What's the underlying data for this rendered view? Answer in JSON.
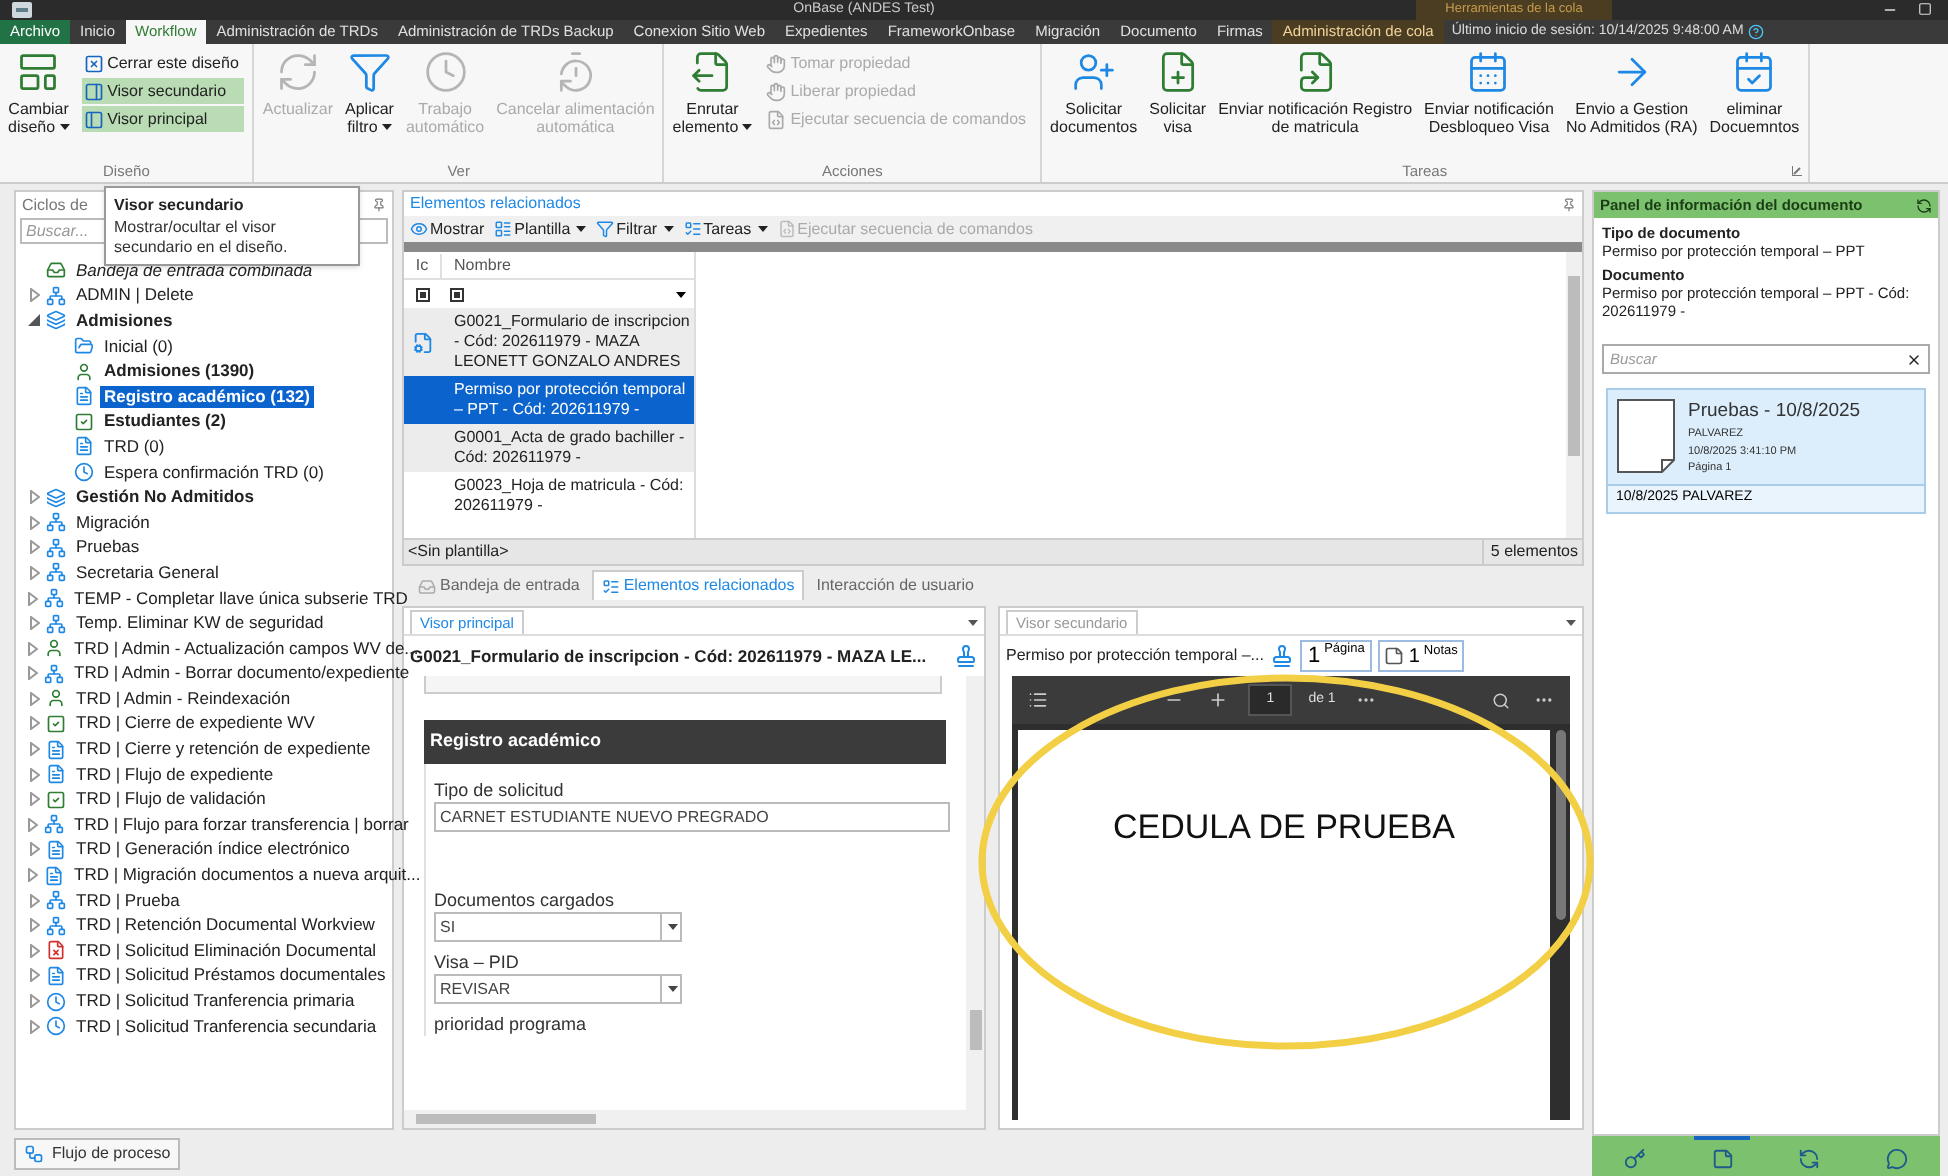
{
  "window": {
    "title": "OnBase (ANDES Test)",
    "context_label": "Herramientas de la cola"
  },
  "tabs": [
    {
      "label": "Archivo",
      "kind": "file",
      "selected": false
    },
    {
      "label": "Inicio",
      "kind": "normal",
      "selected": false
    },
    {
      "label": "Workflow",
      "kind": "normal",
      "selected": true
    },
    {
      "label": "Administración de TRDs",
      "kind": "normal",
      "selected": false
    },
    {
      "label": "Administración de TRDs Backup",
      "kind": "normal",
      "selected": false
    },
    {
      "label": "Conexion Sitio Web",
      "kind": "normal",
      "selected": false
    },
    {
      "label": "Expedientes",
      "kind": "normal",
      "selected": false
    },
    {
      "label": "FrameworkOnbase",
      "kind": "normal",
      "selected": false
    },
    {
      "label": "Migración",
      "kind": "normal",
      "selected": false
    },
    {
      "label": "Documento",
      "kind": "normal",
      "selected": false
    },
    {
      "label": "Firmas",
      "kind": "normal",
      "selected": false
    },
    {
      "label": "Administración de cola",
      "kind": "contextual",
      "selected": false
    }
  ],
  "last_login": "Último inicio de sesión: 10/14/2025 9:48:00 AM",
  "ribbon": [
    {
      "label": "Diseño",
      "items": [
        {
          "kind": "large",
          "label": "Cambiar\ndiseño",
          "dropdown": true,
          "disabled": false
        },
        {
          "kind": "small",
          "label": "Cerrar este diseño",
          "disabled": false,
          "selected": false
        },
        {
          "kind": "small",
          "label": "Visor secundario",
          "disabled": false,
          "selected": true
        },
        {
          "kind": "small",
          "label": "Visor principal",
          "disabled": false,
          "selected": true
        }
      ]
    },
    {
      "label": "Ver",
      "items": [
        {
          "kind": "large",
          "label": "Actualizar",
          "dropdown": false,
          "disabled": true
        },
        {
          "kind": "large",
          "label": "Aplicar\nfiltro",
          "dropdown": true,
          "disabled": false
        },
        {
          "kind": "large",
          "label": "Trabajo\nautomático",
          "dropdown": false,
          "disabled": true
        },
        {
          "kind": "large",
          "label": "Cancelar alimentación\nautomática",
          "dropdown": false,
          "disabled": true
        }
      ]
    },
    {
      "label": "Acciones",
      "items": [
        {
          "kind": "large",
          "label": "Enrutar\nelemento",
          "dropdown": true,
          "disabled": false
        },
        {
          "kind": "small",
          "label": "Tomar propiedad",
          "disabled": true,
          "selected": false
        },
        {
          "kind": "small",
          "label": "Liberar propiedad",
          "disabled": true,
          "selected": false
        },
        {
          "kind": "small",
          "label": "Ejecutar secuencia de comandos",
          "disabled": true,
          "selected": false
        }
      ]
    },
    {
      "label": "Tareas",
      "items": [
        {
          "kind": "large",
          "label": "Solicitar\ndocumentos",
          "dropdown": false,
          "disabled": false
        },
        {
          "kind": "large",
          "label": "Solicitar\nvisa",
          "dropdown": false,
          "disabled": false
        },
        {
          "kind": "large",
          "label": "Enviar notificación Registro\nde matricula",
          "dropdown": false,
          "disabled": false
        },
        {
          "kind": "large",
          "label": "Enviar notificación\nDesbloqueo Visa",
          "dropdown": false,
          "disabled": false
        },
        {
          "kind": "large",
          "label": "Envio a Gestion\nNo Admitidos (RA)",
          "dropdown": false,
          "disabled": false
        },
        {
          "kind": "large",
          "label": "eliminar\nDocuemntos",
          "dropdown": false,
          "disabled": false
        }
      ]
    }
  ],
  "tooltip": {
    "title": "Visor secundario",
    "text": "Mostrar/ocultar el visor secundario en el diseño."
  },
  "sidebar": {
    "title": "Ciclos de",
    "search_placeholder": "Buscar...",
    "items": [
      {
        "label": "Bandeja de entrada combinada",
        "kind": "inbox",
        "bold": false,
        "selected": false
      },
      {
        "label": "ADMIN | Delete",
        "kind": "lifecycle",
        "bold": false,
        "selected": false,
        "expanded": false
      },
      {
        "label": "Admisiones",
        "kind": "stack",
        "bold": true,
        "selected": false,
        "expanded": true,
        "children": [
          {
            "label": "Inicial (0)",
            "kind": "folder",
            "bold": false,
            "selected": false
          },
          {
            "label": "Admisiones (1390)",
            "kind": "person",
            "bold": true,
            "selected": false
          },
          {
            "label": "Registro académico (132)",
            "kind": "document",
            "bold": true,
            "selected": true
          },
          {
            "label": "Estudiantes (2)",
            "kind": "check",
            "bold": true,
            "selected": false
          },
          {
            "label": "TRD (0)",
            "kind": "document",
            "bold": false,
            "selected": false
          },
          {
            "label": "Espera confirmación TRD (0)",
            "kind": "clock",
            "bold": false,
            "selected": false
          }
        ]
      },
      {
        "label": "Gestión No Admitidos",
        "kind": "stack",
        "bold": true,
        "selected": false,
        "expanded": false
      },
      {
        "label": "Migración",
        "kind": "lifecycle",
        "bold": false,
        "selected": false,
        "expanded": false
      },
      {
        "label": "Pruebas",
        "kind": "lifecycle",
        "bold": false,
        "selected": false,
        "expanded": false
      },
      {
        "label": "Secretaria General",
        "kind": "lifecycle",
        "bold": false,
        "selected": false,
        "expanded": false
      },
      {
        "label": "TEMP - Completar llave única subserie TRD",
        "kind": "lifecycle",
        "bold": false,
        "selected": false,
        "expanded": false
      },
      {
        "label": "Temp. Eliminar KW de seguridad",
        "kind": "lifecycle",
        "bold": false,
        "selected": false,
        "expanded": false
      },
      {
        "label": "TRD | Admin - Actualización campos WV de...",
        "kind": "person",
        "bold": false,
        "selected": false,
        "expanded": false
      },
      {
        "label": "TRD | Admin - Borrar documento/expediente",
        "kind": "lifecycle",
        "bold": false,
        "selected": false,
        "expanded": false
      },
      {
        "label": "TRD | Admin - Reindexación",
        "kind": "person",
        "bold": false,
        "selected": false,
        "expanded": false
      },
      {
        "label": "TRD | Cierre de expediente WV",
        "kind": "check",
        "bold": false,
        "selected": false,
        "expanded": false
      },
      {
        "label": "TRD | Cierre y retención de expediente",
        "kind": "document",
        "bold": false,
        "selected": false,
        "expanded": false
      },
      {
        "label": "TRD | Flujo de expediente",
        "kind": "document",
        "bold": false,
        "selected": false,
        "expanded": false
      },
      {
        "label": "TRD | Flujo de validación",
        "kind": "check",
        "bold": false,
        "selected": false,
        "expanded": false
      },
      {
        "label": "TRD | Flujo para forzar transferencia | borrar",
        "kind": "lifecycle",
        "bold": false,
        "selected": false,
        "expanded": false
      },
      {
        "label": "TRD | Generación índice electrónico",
        "kind": "document",
        "bold": false,
        "selected": false,
        "expanded": false
      },
      {
        "label": "TRD | Migración documentos a nueva arquit...",
        "kind": "document",
        "bold": false,
        "selected": false,
        "expanded": false
      },
      {
        "label": "TRD | Prueba",
        "kind": "lifecycle",
        "bold": false,
        "selected": false,
        "expanded": false
      },
      {
        "label": "TRD | Retención Documental Workview",
        "kind": "lifecycle",
        "bold": false,
        "selected": false,
        "expanded": false
      },
      {
        "label": "TRD | Solicitud Eliminación Documental",
        "kind": "delete",
        "bold": false,
        "selected": false,
        "expanded": false
      },
      {
        "label": "TRD | Solicitud Préstamos documentales",
        "kind": "document",
        "bold": false,
        "selected": false,
        "expanded": false
      },
      {
        "label": "TRD | Solicitud Tranferencia primaria",
        "kind": "clock",
        "bold": false,
        "selected": false,
        "expanded": false
      },
      {
        "label": "TRD | Solicitud Tranferencia secundaria",
        "kind": "clock",
        "bold": false,
        "selected": false,
        "expanded": false
      }
    ],
    "footer_button": "Flujo de proceso"
  },
  "related": {
    "title": "Elementos relacionados",
    "toolbar": [
      {
        "label": "Mostrar",
        "dropdown": false,
        "disabled": false
      },
      {
        "label": "Plantilla",
        "dropdown": true,
        "disabled": false
      },
      {
        "label": "Filtrar",
        "dropdown": true,
        "disabled": false
      },
      {
        "label": "Tareas",
        "dropdown": true,
        "disabled": false
      },
      {
        "label": "Ejecutar secuencia de comandos",
        "dropdown": false,
        "disabled": true
      }
    ],
    "columns": [
      "Ic",
      "Nombre"
    ],
    "rows": [
      {
        "name": "G0021_Formulario de inscripcion - Cód: 202611979 - MAZA LEONETT GONZALO ANDRES",
        "selected": false
      },
      {
        "name": "Permiso por protección temporal – PPT - Cód: 202611979 -",
        "selected": true
      },
      {
        "name": "G0001_Acta de grado bachiller - Cód: 202611979 -",
        "selected": false
      },
      {
        "name": "G0023_Hoja de matricula - Cód: 202611979 -",
        "selected": false
      }
    ],
    "template": "<Sin plantilla>",
    "count": "5 elementos"
  },
  "bottom_tabs": [
    {
      "label": "Bandeja de entrada",
      "selected": false
    },
    {
      "label": "Elementos relacionados",
      "selected": true
    },
    {
      "label": "Interacción de usuario",
      "selected": false
    }
  ],
  "primary_viewer": {
    "tab": "Visor principal",
    "title": "G0021_Formulario de inscripcion - Cód: 202611979 - MAZA LE...",
    "section": "Registro académico",
    "fields": [
      {
        "kind": "text",
        "label": "Tipo de solicitud",
        "value": "CARNET ESTUDIANTE NUEVO PREGRADO"
      },
      {
        "kind": "select",
        "label": "Documentos cargados",
        "value": "SI"
      },
      {
        "kind": "select",
        "label": "Visa – PID",
        "value": "REVISAR"
      },
      {
        "kind": "label",
        "label": "prioridad programa"
      }
    ]
  },
  "secondary_viewer": {
    "tab": "Visor secundario",
    "title": "Permiso por protección temporal –...",
    "page": "1",
    "page_label": "Página",
    "notes_label": "Notas",
    "notes_count": "1",
    "pdf": {
      "page_input": "1",
      "page_total": "de 1",
      "content": "CEDULA DE PRUEBA"
    }
  },
  "info_panel": {
    "title": "Panel de información del documento",
    "doc_type_label": "Tipo de documento",
    "doc_type": "Permiso por protección temporal – PPT",
    "doc_label": "Documento",
    "doc": "Permiso por protección temporal – PPT - Cód: 202611979 -",
    "search_placeholder": "Buscar",
    "card": {
      "title": "Pruebas - 10/8/2025",
      "user": "PALVAREZ",
      "date": "10/8/2025 3:41:10 PM",
      "page": "Página 1",
      "footer": "10/8/2025 PALVAREZ"
    },
    "bottom_icons": [
      {
        "selected": false
      },
      {
        "selected": true
      },
      {
        "selected": false
      },
      {
        "selected": false
      }
    ]
  }
}
